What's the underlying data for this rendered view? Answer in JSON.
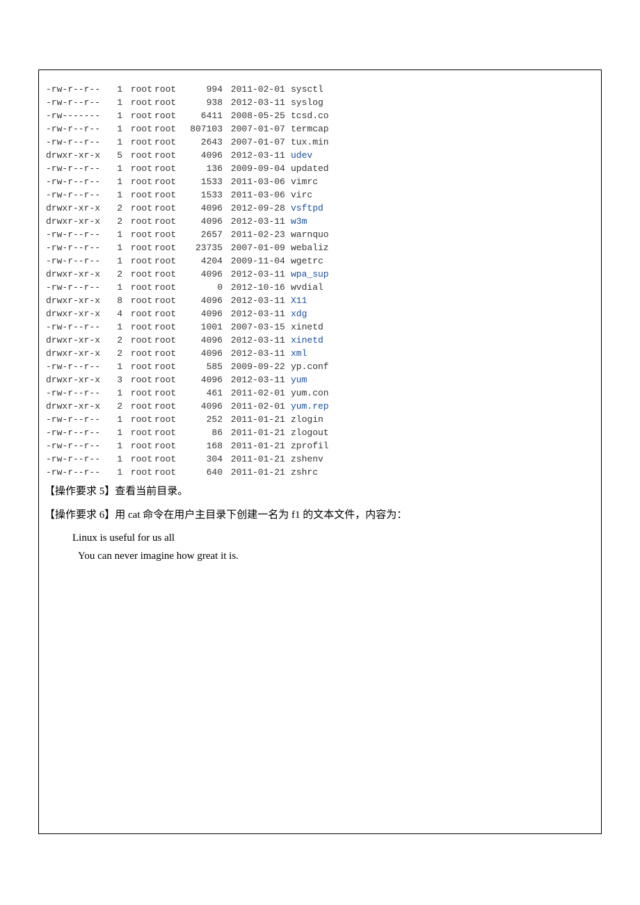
{
  "listing": [
    {
      "perm": "-rw-r--r--",
      "links": "1",
      "owner": "root",
      "group": "root",
      "size": "994",
      "date": "2011-02-01",
      "name": "sysctl",
      "dir": false
    },
    {
      "perm": "-rw-r--r--",
      "links": "1",
      "owner": "root",
      "group": "root",
      "size": "938",
      "date": "2012-03-11",
      "name": "syslog",
      "dir": false
    },
    {
      "perm": "-rw-------",
      "links": "1",
      "owner": "root",
      "group": "root",
      "size": "6411",
      "date": "2008-05-25",
      "name": "tcsd.co",
      "dir": false
    },
    {
      "perm": "-rw-r--r--",
      "links": "1",
      "owner": "root",
      "group": "root",
      "size": "807103",
      "date": "2007-01-07",
      "name": "termcap",
      "dir": false
    },
    {
      "perm": "-rw-r--r--",
      "links": "1",
      "owner": "root",
      "group": "root",
      "size": "2643",
      "date": "2007-01-07",
      "name": "tux.min",
      "dir": false
    },
    {
      "perm": "drwxr-xr-x",
      "links": "5",
      "owner": "root",
      "group": "root",
      "size": "4096",
      "date": "2012-03-11",
      "name": "udev",
      "dir": true
    },
    {
      "perm": "-rw-r--r--",
      "links": "1",
      "owner": "root",
      "group": "root",
      "size": "136",
      "date": "2009-09-04",
      "name": "updated",
      "dir": false
    },
    {
      "perm": "-rw-r--r--",
      "links": "1",
      "owner": "root",
      "group": "root",
      "size": "1533",
      "date": "2011-03-06",
      "name": "vimrc",
      "dir": false
    },
    {
      "perm": "-rw-r--r--",
      "links": "1",
      "owner": "root",
      "group": "root",
      "size": "1533",
      "date": "2011-03-06",
      "name": "virc",
      "dir": false
    },
    {
      "perm": "drwxr-xr-x",
      "links": "2",
      "owner": "root",
      "group": "root",
      "size": "4096",
      "date": "2012-09-28",
      "name": "vsftpd",
      "dir": true
    },
    {
      "perm": "drwxr-xr-x",
      "links": "2",
      "owner": "root",
      "group": "root",
      "size": "4096",
      "date": "2012-03-11",
      "name": "w3m",
      "dir": true
    },
    {
      "perm": "-rw-r--r--",
      "links": "1",
      "owner": "root",
      "group": "root",
      "size": "2657",
      "date": "2011-02-23",
      "name": "warnquo",
      "dir": false
    },
    {
      "perm": "-rw-r--r--",
      "links": "1",
      "owner": "root",
      "group": "root",
      "size": "23735",
      "date": "2007-01-09",
      "name": "webaliz",
      "dir": false
    },
    {
      "perm": "-rw-r--r--",
      "links": "1",
      "owner": "root",
      "group": "root",
      "size": "4204",
      "date": "2009-11-04",
      "name": "wgetrc",
      "dir": false
    },
    {
      "perm": "drwxr-xr-x",
      "links": "2",
      "owner": "root",
      "group": "root",
      "size": "4096",
      "date": "2012-03-11",
      "name": "wpa_sup",
      "dir": true
    },
    {
      "perm": "-rw-r--r--",
      "links": "1",
      "owner": "root",
      "group": "root",
      "size": "0",
      "date": "2012-10-16",
      "name": "wvdial",
      "dir": false
    },
    {
      "perm": "drwxr-xr-x",
      "links": "8",
      "owner": "root",
      "group": "root",
      "size": "4096",
      "date": "2012-03-11",
      "name": "X11",
      "dir": true
    },
    {
      "perm": "drwxr-xr-x",
      "links": "4",
      "owner": "root",
      "group": "root",
      "size": "4096",
      "date": "2012-03-11",
      "name": "xdg",
      "dir": true
    },
    {
      "perm": "-rw-r--r--",
      "links": "1",
      "owner": "root",
      "group": "root",
      "size": "1001",
      "date": "2007-03-15",
      "name": "xinetd",
      "dir": false
    },
    {
      "perm": "drwxr-xr-x",
      "links": "2",
      "owner": "root",
      "group": "root",
      "size": "4096",
      "date": "2012-03-11",
      "name": "xinetd",
      "dir": true
    },
    {
      "perm": "drwxr-xr-x",
      "links": "2",
      "owner": "root",
      "group": "root",
      "size": "4096",
      "date": "2012-03-11",
      "name": "xml",
      "dir": true
    },
    {
      "perm": "-rw-r--r--",
      "links": "1",
      "owner": "root",
      "group": "root",
      "size": "585",
      "date": "2009-09-22",
      "name": "yp.conf",
      "dir": false
    },
    {
      "perm": "drwxr-xr-x",
      "links": "3",
      "owner": "root",
      "group": "root",
      "size": "4096",
      "date": "2012-03-11",
      "name": "yum",
      "dir": true
    },
    {
      "perm": "-rw-r--r--",
      "links": "1",
      "owner": "root",
      "group": "root",
      "size": "461",
      "date": "2011-02-01",
      "name": "yum.con",
      "dir": false
    },
    {
      "perm": "drwxr-xr-x",
      "links": "2",
      "owner": "root",
      "group": "root",
      "size": "4096",
      "date": "2011-02-01",
      "name": "yum.rep",
      "dir": true
    },
    {
      "perm": "-rw-r--r--",
      "links": "1",
      "owner": "root",
      "group": "root",
      "size": "252",
      "date": "2011-01-21",
      "name": "zlogin",
      "dir": false
    },
    {
      "perm": "-rw-r--r--",
      "links": "1",
      "owner": "root",
      "group": "root",
      "size": "86",
      "date": "2011-01-21",
      "name": "zlogout",
      "dir": false
    },
    {
      "perm": "-rw-r--r--",
      "links": "1",
      "owner": "root",
      "group": "root",
      "size": "168",
      "date": "2011-01-21",
      "name": "zprofil",
      "dir": false
    },
    {
      "perm": "-rw-r--r--",
      "links": "1",
      "owner": "root",
      "group": "root",
      "size": "304",
      "date": "2011-01-21",
      "name": "zshenv",
      "dir": false
    },
    {
      "perm": "-rw-r--r--",
      "links": "1",
      "owner": "root",
      "group": "root",
      "size": "640",
      "date": "2011-01-21",
      "name": "zshrc",
      "dir": false
    }
  ],
  "task5": "【操作要求 5】查看当前目录。",
  "task6": "【操作要求 6】用 cat 命令在用户主目录下创建一名为 f1 的文本文件，内容为：",
  "content1": "Linux is useful for us all",
  "content2": "You can never imagine how great it is."
}
